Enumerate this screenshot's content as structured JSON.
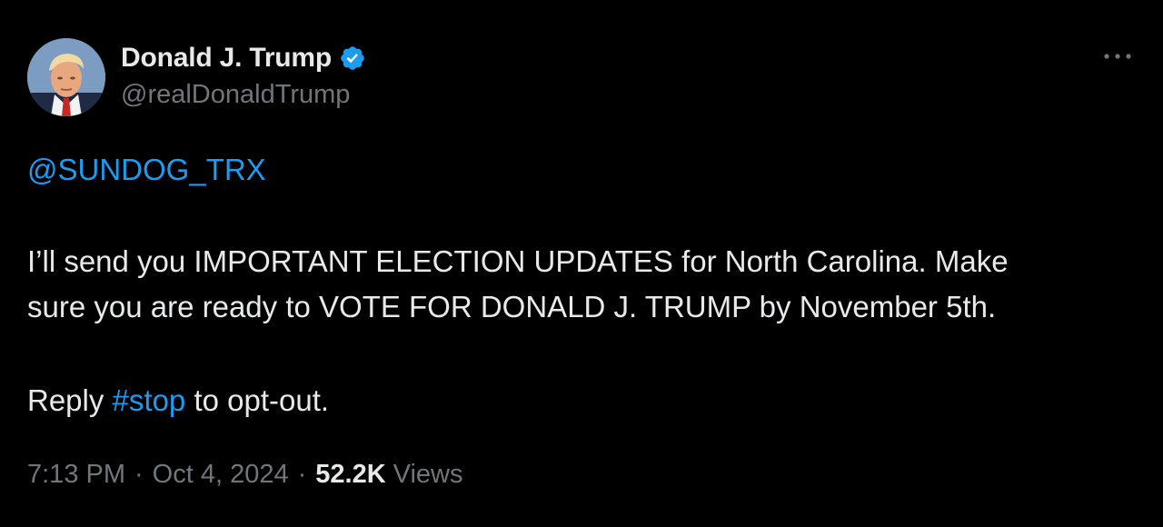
{
  "author": {
    "display_name": "Donald J. Trump",
    "handle": "@realDonaldTrump",
    "verified": true,
    "verified_color": "#1d9bf0"
  },
  "tweet": {
    "mention": "@SUNDOG_TRX",
    "line1": "I’ll send you IMPORTANT ELECTION UPDATES for North Carolina. Make",
    "line2": "sure you are ready to VOTE FOR DONALD J. TRUMP by November 5th.",
    "reply_prefix": "Reply ",
    "hashtag": "#stop",
    "reply_suffix": " to opt-out."
  },
  "meta": {
    "time": "7:13 PM",
    "separator": "·",
    "date": "Oct 4, 2024",
    "views_count": "52.2K",
    "views_label": "Views"
  },
  "icons": {
    "more": "more-horizontal-icon",
    "verified": "verified-badge-icon"
  },
  "colors": {
    "background": "#000000",
    "text_primary": "#e7e9ea",
    "text_secondary": "#71767b",
    "link": "#1d9bf0"
  }
}
